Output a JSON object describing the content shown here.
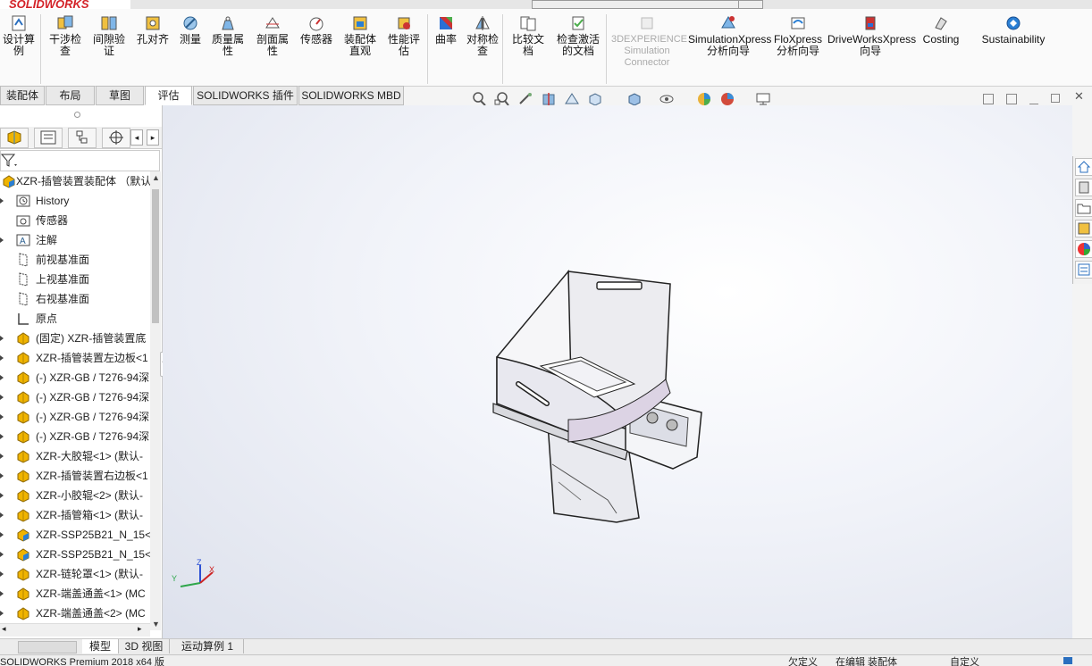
{
  "app": {
    "logo": "SOLIDWORKS"
  },
  "ribbon": {
    "buttons": [
      {
        "key": "design-study",
        "label": "设计算例",
        "icon": "design-study-icon"
      },
      {
        "key": "interference",
        "label": "干涉检查",
        "icon": "interference-icon"
      },
      {
        "key": "clearance",
        "label": "间隙验证",
        "icon": "clearance-icon"
      },
      {
        "key": "hole-align",
        "label": "孔对齐",
        "icon": "hole-align-icon"
      },
      {
        "key": "measure",
        "label": "测量",
        "icon": "measure-icon"
      },
      {
        "key": "mass-props",
        "label": "质量属性",
        "icon": "mass-props-icon"
      },
      {
        "key": "section-props",
        "label": "剖面属性",
        "icon": "section-props-icon"
      },
      {
        "key": "sensor",
        "label": "传感器",
        "icon": "sensor-icon"
      },
      {
        "key": "assembly-viz",
        "label": "装配体直观",
        "icon": "assembly-viz-icon"
      },
      {
        "key": "performance",
        "label": "性能评估",
        "icon": "performance-icon"
      },
      {
        "key": "curvature",
        "label": "曲率",
        "icon": "curvature-icon"
      },
      {
        "key": "symmetry",
        "label": "对称检查",
        "icon": "symmetry-icon"
      },
      {
        "key": "compare",
        "label": "比较文档",
        "icon": "compare-icon"
      },
      {
        "key": "check-active",
        "label": "检查激活的文档",
        "icon": "check-active-icon"
      },
      {
        "key": "3dexp",
        "label": "3DEXPERIENCE Simulation Connector",
        "icon": "3dexperience-icon"
      },
      {
        "key": "simxpress",
        "label": "SimulationXpress 分析向导",
        "icon": "simulationxpress-icon"
      },
      {
        "key": "floxpress",
        "label": "FloXpress 分析向导",
        "icon": "floxpress-icon"
      },
      {
        "key": "driveworks",
        "label": "DriveWorksXpress 向导",
        "icon": "driveworks-icon"
      },
      {
        "key": "costing",
        "label": "Costing",
        "icon": "costing-icon"
      },
      {
        "key": "sustainability",
        "label": "Sustainability",
        "icon": "sustainability-icon"
      }
    ]
  },
  "tabs": [
    "装配体",
    "布局",
    "草图",
    "评估",
    "SOLIDWORKS 插件",
    "SOLIDWORKS MBD"
  ],
  "active_tab": "评估",
  "tree": {
    "root": "XZR-插管装置装配体 （默认",
    "items": [
      {
        "label": "History",
        "icon": "history-icon",
        "expand": true
      },
      {
        "label": "传感器",
        "icon": "sensor-folder-icon",
        "expand": false
      },
      {
        "label": "注解",
        "icon": "annotation-icon",
        "expand": true
      },
      {
        "label": "前视基准面",
        "icon": "plane-icon",
        "expand": false
      },
      {
        "label": "上视基准面",
        "icon": "plane-icon",
        "expand": false
      },
      {
        "label": "右视基准面",
        "icon": "plane-icon",
        "expand": false
      },
      {
        "label": "原点",
        "icon": "origin-icon",
        "expand": false
      },
      {
        "label": "(固定) XZR-插管装置底",
        "icon": "part-icon",
        "expand": true
      },
      {
        "label": "XZR-插管装置左边板<1",
        "icon": "part-icon",
        "expand": true
      },
      {
        "label": "(-) XZR-GB / T276-94深",
        "icon": "part-icon",
        "expand": true
      },
      {
        "label": "(-) XZR-GB / T276-94深",
        "icon": "part-icon",
        "expand": true
      },
      {
        "label": "(-) XZR-GB / T276-94深",
        "icon": "part-icon",
        "expand": true
      },
      {
        "label": "(-) XZR-GB / T276-94深",
        "icon": "part-icon",
        "expand": true
      },
      {
        "label": "XZR-大胶辊<1> (默认-",
        "icon": "part-icon",
        "expand": true
      },
      {
        "label": "XZR-插管装置右边板<1",
        "icon": "part-icon",
        "expand": true
      },
      {
        "label": "XZR-小胶辊<2> (默认-",
        "icon": "part-icon",
        "expand": true
      },
      {
        "label": "XZR-插管箱<1> (默认-",
        "icon": "part-icon",
        "expand": true
      },
      {
        "label": "XZR-SSP25B21_N_15<",
        "icon": "subassembly-icon",
        "expand": true
      },
      {
        "label": "XZR-SSP25B21_N_15<",
        "icon": "subassembly-icon",
        "expand": true
      },
      {
        "label": "XZR-链轮罩<1> (默认-",
        "icon": "part-icon",
        "expand": true
      },
      {
        "label": "XZR-端盖通盖<1> (MC",
        "icon": "part-icon",
        "expand": true
      },
      {
        "label": "XZR-端盖通盖<2> (MC",
        "icon": "part-icon",
        "expand": true
      }
    ]
  },
  "bottom_tabs": [
    "模型",
    "3D 视图",
    "运动算例 1"
  ],
  "active_bottom_tab": "模型",
  "status": {
    "left": "SOLIDWORKS Premium 2018 x64 版",
    "undefined": "欠定义",
    "editing": "在编辑 装配体",
    "custom": "自定义"
  },
  "triad": {
    "x": "X",
    "y": "Y",
    "z": "Z"
  },
  "colors": {
    "accent": "#d32127",
    "part": "#f0b400",
    "subasm": "#2a7fd4"
  }
}
